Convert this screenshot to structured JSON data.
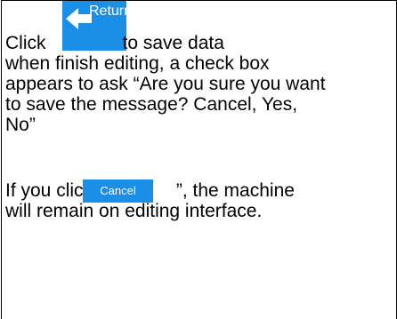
{
  "return_button": {
    "label": "Return",
    "icon": "left-arrow-icon",
    "color": "#1b8fe8"
  },
  "cancel_button": {
    "label": "Cancel",
    "color": "#1b8fe8"
  },
  "text": {
    "click_prefix": "Click",
    "save_suffix": "to save data",
    "line2": "when finish editing, a check box",
    "line3": "appears to ask “Are you sure you want",
    "line4": "to save the message? Cancel, Yes,",
    "line5": "No”",
    "if_prefix": "If you click “",
    "if_suffix": "”, the machine",
    "line7": "will remain on editing interface."
  }
}
